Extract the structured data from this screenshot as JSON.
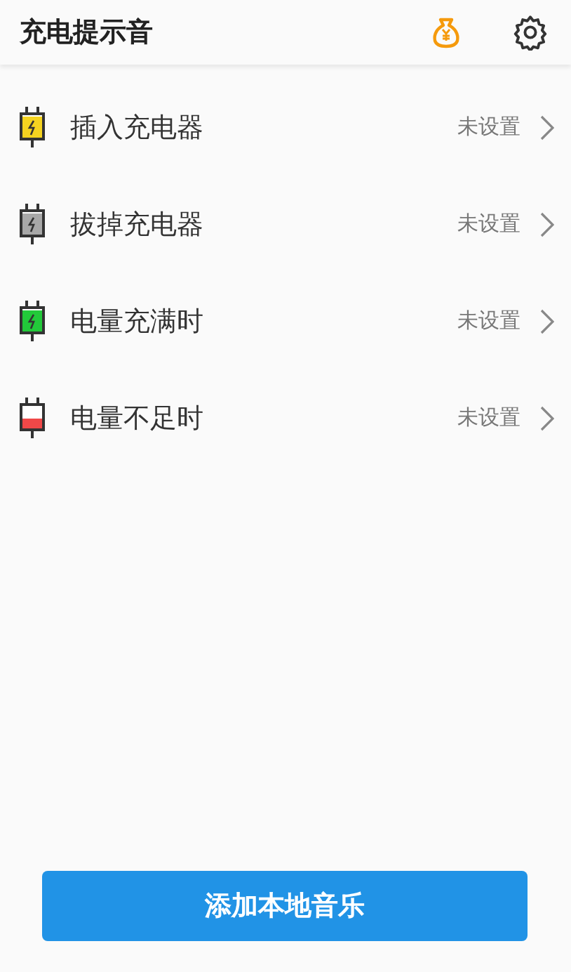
{
  "header": {
    "title": "充电提示音"
  },
  "items": [
    {
      "kind": "plug",
      "color": "#f5d320",
      "label": "插入充电器",
      "value": "未设置"
    },
    {
      "kind": "plug",
      "color": "#a8a8a8",
      "label": "拔掉充电器",
      "value": "未设置"
    },
    {
      "kind": "plug",
      "color": "#22c93a",
      "label": "电量充满时",
      "value": "未设置"
    },
    {
      "kind": "low",
      "color": "#f04848",
      "label": "电量不足时",
      "value": "未设置"
    }
  ],
  "button": {
    "label": "添加本地音乐"
  }
}
